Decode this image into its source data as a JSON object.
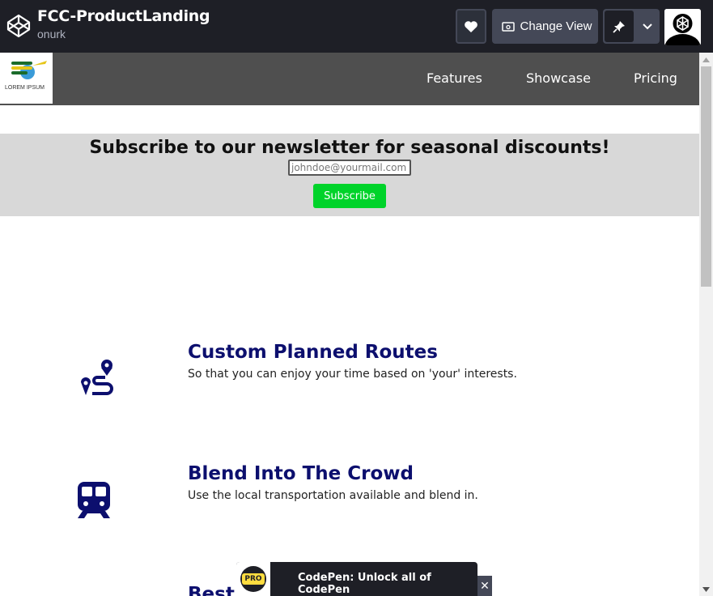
{
  "codepen": {
    "pen_title": "FCC-ProductLanding",
    "author": "onurk",
    "change_view_label": "Change View",
    "promo_text": "CodePen: Unlock all of CodePen",
    "promo_badge": "PRO",
    "close_glyph": "✕"
  },
  "site": {
    "logo_text": "LOREM IPSUM",
    "nav": [
      "Features",
      "Showcase",
      "Pricing"
    ],
    "newsletter": {
      "title": "Subscribe to our newsletter for seasonal discounts!",
      "placeholder": "johndoe@yourmail.com",
      "button": "Subscribe"
    },
    "features": [
      {
        "title": "Custom Planned Routes",
        "desc": "So that you can enjoy your time based on 'your' interests.",
        "icon": "route-icon"
      },
      {
        "title": "Blend Into The Crowd",
        "desc": "Use the local transportation available and blend in.",
        "icon": "train-icon"
      },
      {
        "title": "Best L",
        "desc": "",
        "icon": ""
      }
    ],
    "colors": {
      "accent_green": "#00d32a",
      "title_navy": "#0c0f6e",
      "header_gray": "#4f4f4f"
    }
  }
}
